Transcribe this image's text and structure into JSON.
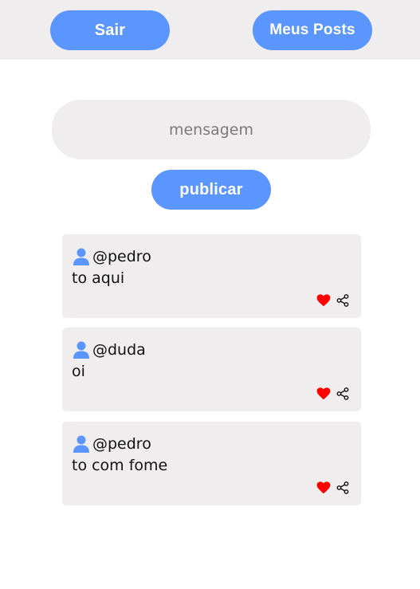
{
  "header": {
    "logout_label": "Sair",
    "my_posts_label": "Meus Posts"
  },
  "composer": {
    "placeholder": "mensagem",
    "value": "",
    "publish_label": "publicar"
  },
  "posts": [
    {
      "username": "@pedro",
      "text": "to aqui"
    },
    {
      "username": "@duda",
      "text": "oi"
    },
    {
      "username": "@pedro",
      "text": "to com fome"
    }
  ],
  "colors": {
    "accent": "#5b96ff",
    "surface": "#efeded",
    "like": "#ff0000"
  },
  "icons": {
    "avatar": "user-icon",
    "like": "heart-icon",
    "share": "share-icon"
  }
}
